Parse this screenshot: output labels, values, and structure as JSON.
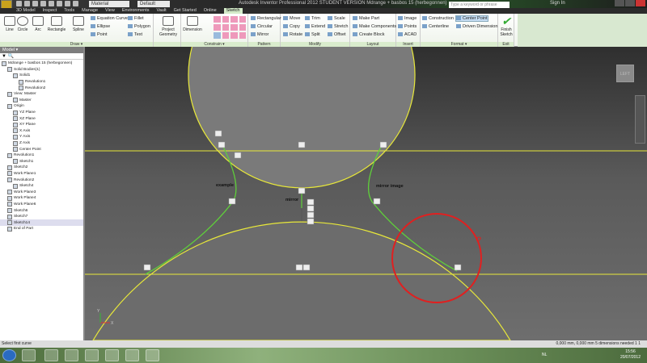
{
  "titlebar": {
    "material": "Material",
    "appearance": "Default",
    "title": "Autodesk Inventor Professional 2012 STUDENT VERSION  Mdrange + basbos 15 (herbegonnen)",
    "search_placeholder": "Type a keyword or phrase",
    "signin": "Sign In"
  },
  "tabs": [
    "3D Model",
    "Inspect",
    "Tools",
    "Manage",
    "View",
    "Environments",
    "Vault",
    "Get Started",
    "Online",
    "Sketch"
  ],
  "ribbon": {
    "draw": {
      "label": "Draw ▾",
      "big": [
        "Line",
        "Circle",
        "Arc",
        "Rectangle",
        "Spline"
      ],
      "small": [
        "Equation Curve",
        "Ellipse",
        "Point",
        "Fillet",
        "Polygon",
        "Text"
      ]
    },
    "project_geometry": "Project Geometry",
    "constrain": {
      "label": "Constrain ▾",
      "dimension": "Dimension"
    },
    "pattern": {
      "label": "Pattern",
      "items": [
        "Rectangular",
        "Circular",
        "Mirror"
      ]
    },
    "modify": {
      "label": "Modify",
      "items": [
        "Move",
        "Copy",
        "Rotate",
        "Trim",
        "Extend",
        "Split",
        "Scale",
        "Stretch",
        "Offset"
      ]
    },
    "layout": {
      "label": "Layout",
      "items": [
        "Make Part",
        "Make Components",
        "Create Block"
      ]
    },
    "insert": {
      "label": "Insert",
      "items": [
        "Image",
        "Points",
        "ACAD"
      ]
    },
    "format": {
      "label": "Format ▾",
      "items": [
        "Construction",
        "Centerline",
        "Center Point",
        "Driven Dimension"
      ]
    },
    "exit": {
      "label": "Exit",
      "finish": "Finish Sketch"
    }
  },
  "browser": {
    "title": "Model ▾",
    "items": [
      "Mdrange + basbos 15 (herbegonnen)",
      "Solid Bodies(1)",
      "Solid1",
      "Revolution1",
      "Revolution2",
      "View: Master",
      "Master",
      "Origin",
      "YZ Plane",
      "XZ Plane",
      "XY Plane",
      "X Axis",
      "Y Axis",
      "Z Axis",
      "Center Point",
      "Revolution1",
      "Sketch1",
      "Sketch2",
      "Work Plane1",
      "Revolution2",
      "Sketch4",
      "Work Plane3",
      "Work Plane4",
      "Work Plane6",
      "Sketch6",
      "Sketch7",
      "Sketch14",
      "End of Part"
    ],
    "selected": 26
  },
  "viewport": {
    "labels": {
      "example": "example",
      "mirror": "mirror",
      "mirror_image": "mirror image",
      "question": "?"
    },
    "viewcube": "LEFT",
    "axis_x": "X",
    "axis_y": "Y"
  },
  "status": {
    "prompt": "Select first curve",
    "readout": "0,000 mm, 0,000 mm  5 dimensions needed  1    1"
  },
  "taskbar": {
    "lang": "NL",
    "time": "15:56",
    "date": "20/07/2012"
  },
  "colors": {
    "sketch": "#e8e83a",
    "green": "#5fd03a",
    "red": "#e02020"
  }
}
